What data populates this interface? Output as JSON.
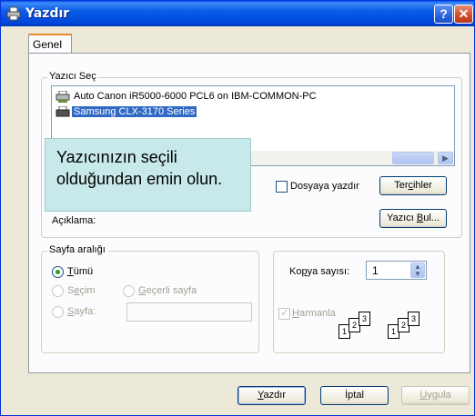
{
  "window": {
    "title": "Yazdır",
    "help_glyph": "?",
    "close_glyph": "✕"
  },
  "tabs": [
    {
      "label": "Genel"
    }
  ],
  "printer_group": {
    "label": "Yazıcı Seç",
    "printers": [
      {
        "name": "Auto Canon iR5000-6000 PCL6 on IBM-COMMON-PC",
        "selected": false
      },
      {
        "name": "Samsung CLX-3170 Series",
        "selected": true
      }
    ]
  },
  "callout": {
    "line1": "Yazıcınızın seçili",
    "line2": "olduğundan emin olun."
  },
  "print_to_file": {
    "label": "Dosyaya yazdır",
    "checked": false
  },
  "preferences_button": {
    "pre": "Ter",
    "accel": "c",
    "post": "ihler"
  },
  "description": {
    "label": "Açıklama:"
  },
  "find_printer_button": {
    "pre": "Yazıcı ",
    "accel": "B",
    "post": "ul..."
  },
  "page_range": {
    "label": "Sayfa aralığı",
    "all": {
      "accel": "T",
      "rest": "ümü",
      "selected": true
    },
    "selection": {
      "pre": "S",
      "accel": "e",
      "post": "çim",
      "enabled": false
    },
    "current": {
      "accel": "G",
      "rest": "eçerli sayfa",
      "enabled": false
    },
    "pages": {
      "accel": "S",
      "rest": "ayfa:",
      "enabled": false,
      "value": ""
    }
  },
  "copies": {
    "label_pre": "Ko",
    "label_accel": "p",
    "label_post": "ya sayısı:",
    "value": "1",
    "collate": {
      "accel": "H",
      "rest": "armanla",
      "checked": true,
      "enabled": false
    },
    "pages_glyphs": [
      "1",
      "2",
      "3"
    ]
  },
  "footer": {
    "print": {
      "accel": "Y",
      "rest": "azdır"
    },
    "cancel": {
      "label": "İptal"
    },
    "apply": {
      "accel": "U",
      "rest": "ygula",
      "enabled": false
    }
  },
  "scroll": {
    "arrow": "▶"
  },
  "spin_arrows": {
    "up": "▲",
    "down": "▼"
  },
  "colors": {
    "titlebar": "#0a5ce8",
    "selection": "#316ac5",
    "callout": "#c8e9e9",
    "radio_dot": "#21a121"
  },
  "icons": [
    "printer-icon",
    "help-icon",
    "close-icon"
  ]
}
